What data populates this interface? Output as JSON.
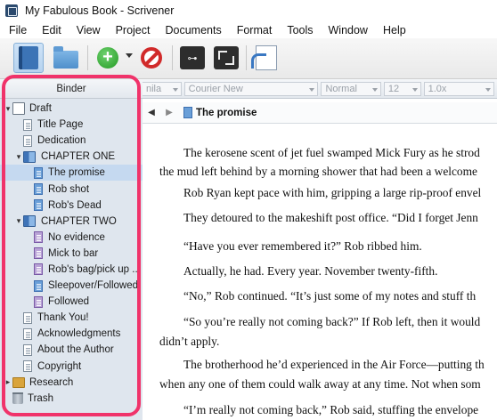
{
  "window": {
    "title": "My Fabulous Book - Scrivener"
  },
  "menu": [
    "File",
    "Edit",
    "View",
    "Project",
    "Documents",
    "Format",
    "Tools",
    "Window",
    "Help"
  ],
  "toolbar": {
    "icons": [
      "binder-icon",
      "collections-icon",
      "add-icon",
      "delete-icon",
      "keywords-icon",
      "fullscreen-icon",
      "compile-icon"
    ]
  },
  "binder": {
    "header": "Binder",
    "items": [
      {
        "label": "Draft",
        "level": 0,
        "type": "draft",
        "expanded": true
      },
      {
        "label": "Title Page",
        "level": 1,
        "type": "doc"
      },
      {
        "label": "Dedication",
        "level": 1,
        "type": "doc"
      },
      {
        "label": "CHAPTER ONE",
        "level": 1,
        "type": "chapter",
        "expanded": true
      },
      {
        "label": "The promise",
        "level": 2,
        "type": "doc-blue",
        "selected": true
      },
      {
        "label": "Rob shot",
        "level": 2,
        "type": "doc-blue"
      },
      {
        "label": "Rob's Dead",
        "level": 2,
        "type": "doc-blue"
      },
      {
        "label": "CHAPTER TWO",
        "level": 1,
        "type": "chapter",
        "expanded": true
      },
      {
        "label": "No evidence",
        "level": 2,
        "type": "doc-purple"
      },
      {
        "label": "Mick to bar",
        "level": 2,
        "type": "doc-purple"
      },
      {
        "label": "Rob's bag/pick up ...",
        "level": 2,
        "type": "doc-purple"
      },
      {
        "label": "Sleepover/Followed",
        "level": 2,
        "type": "doc-blue"
      },
      {
        "label": "Followed",
        "level": 2,
        "type": "doc-purple"
      },
      {
        "label": "Thank You!",
        "level": 1,
        "type": "doc"
      },
      {
        "label": "Acknowledgments",
        "level": 1,
        "type": "doc"
      },
      {
        "label": "About the Author",
        "level": 1,
        "type": "doc"
      },
      {
        "label": "Copyright",
        "level": 1,
        "type": "doc"
      },
      {
        "label": "Research",
        "level": 0,
        "type": "research",
        "expanded": false
      },
      {
        "label": "Trash",
        "level": 0,
        "type": "trash"
      }
    ]
  },
  "format_bar": {
    "style": "nila",
    "font": "Courier New",
    "weight": "Normal",
    "size": "12",
    "spacing": "1.0x"
  },
  "editor": {
    "doc_title": "The promise",
    "lines": [
      "The kerosene scent of jet fuel swamped Mick Fury as he strod",
      "the mud left behind by a morning shower that had been a welcome",
      "Rob Ryan kept pace with him, gripping a large rip-proof envel",
      "They detoured to the makeshift post office. “Did I forget Jenn",
      "“Have you ever remembered it?” Rob ribbed him.",
      "Actually, he had. Every year. November twenty-fifth.",
      "“No,” Rob continued. “It’s just some of my notes and stuff th",
      "“So you’re really not coming back?” If Rob left, then it would",
      "didn’t apply.",
      "The brotherhood he’d experienced in the Air Force—putting th",
      "when any one of them could walk away at any time. Not when som",
      "“I’m really not coming back,” Rob said, stuffing the envelope"
    ]
  }
}
